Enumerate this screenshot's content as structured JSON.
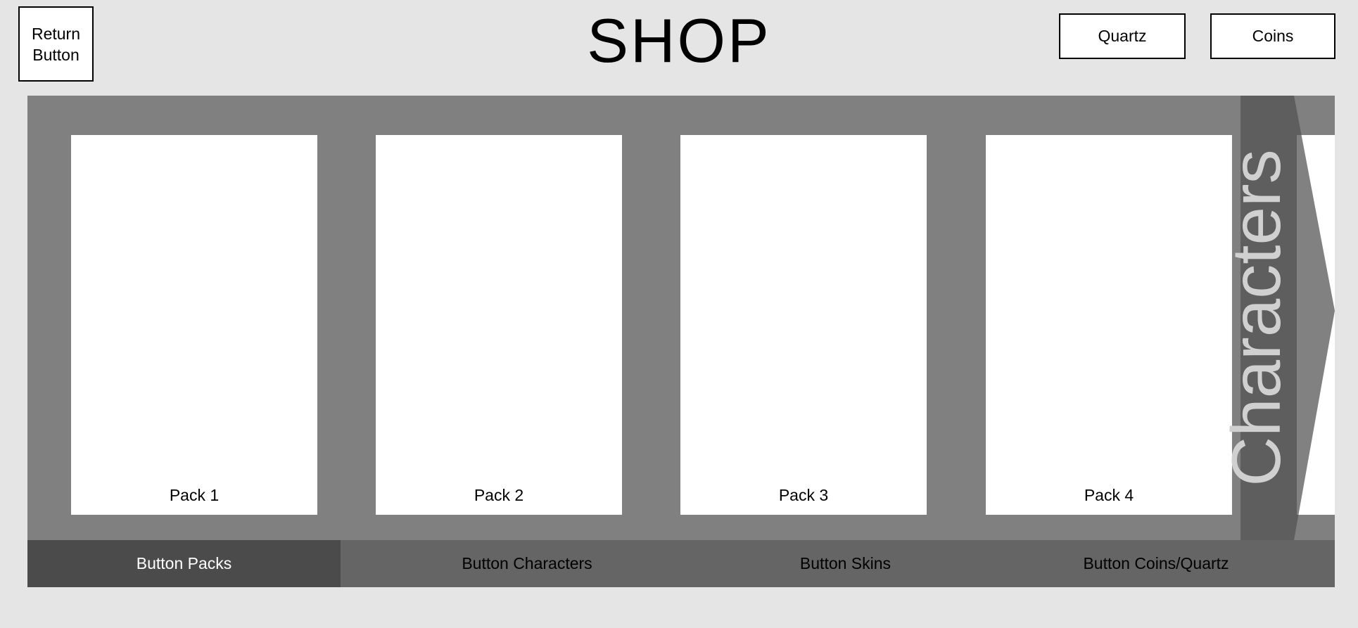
{
  "header": {
    "return_button": [
      "Return",
      "Button"
    ],
    "title": "SHOP",
    "currencies": {
      "quartz": "Quartz",
      "coins": "Coins"
    }
  },
  "carousel": {
    "packs": [
      {
        "label": "Pack 1"
      },
      {
        "label": "Pack 2"
      },
      {
        "label": "Pack 3"
      },
      {
        "label": "Pack 4"
      }
    ],
    "next_tab_label": "Characters"
  },
  "categories": [
    {
      "label": "Button Packs",
      "active": true
    },
    {
      "label": "Button Characters",
      "active": false
    },
    {
      "label": "Button Skins",
      "active": false
    },
    {
      "label": "Button Coins/Quartz",
      "active": false
    }
  ],
  "colors": {
    "background": "#e5e5e5",
    "carousel_bg": "#808080",
    "category_bar": "#656565",
    "category_active": "#4b4b4b",
    "next_tab": "#505050"
  }
}
